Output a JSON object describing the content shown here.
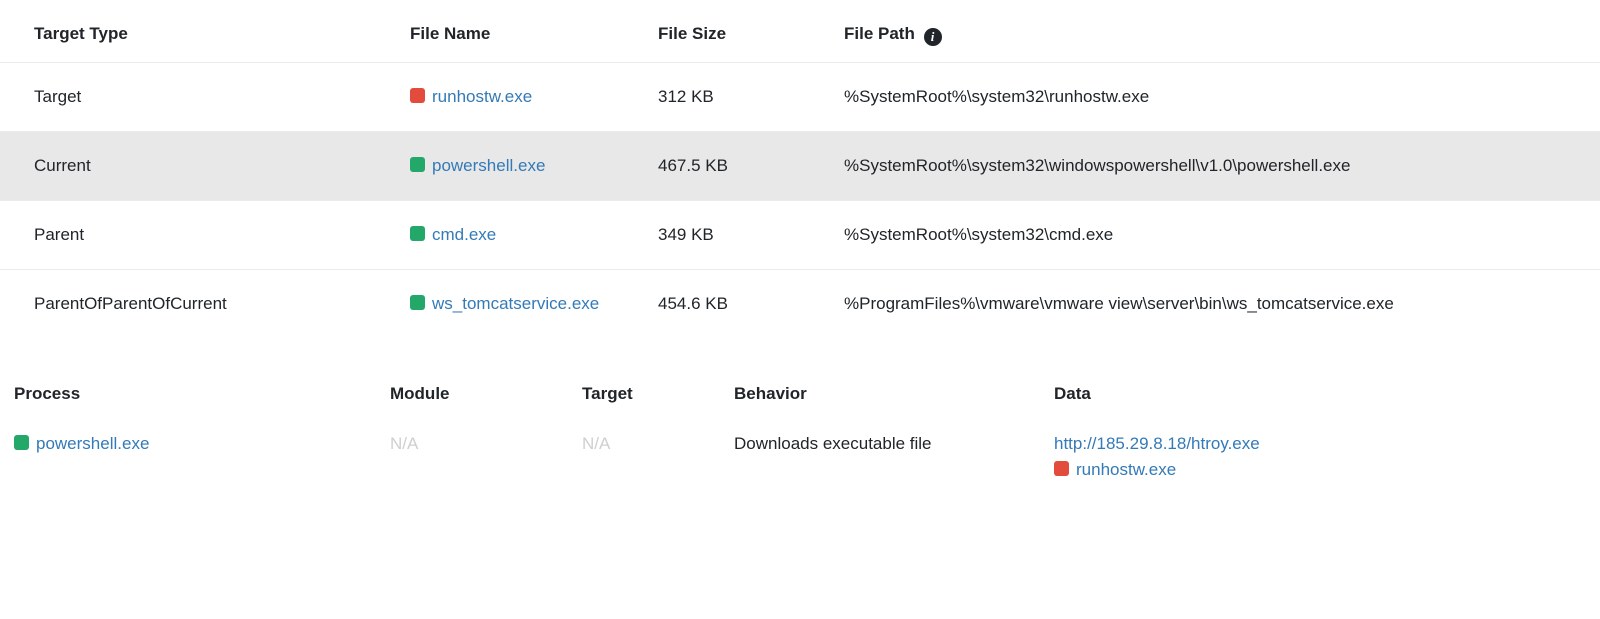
{
  "topTable": {
    "headers": {
      "targetType": "Target Type",
      "fileName": "File Name",
      "fileSize": "File Size",
      "filePath": "File Path"
    },
    "rows": [
      {
        "targetType": "Target",
        "fileName": "runhostw.exe",
        "fileSize": "312 KB",
        "filePath": "%SystemRoot%\\system32\\runhostw.exe",
        "status": "red",
        "alt": false
      },
      {
        "targetType": "Current",
        "fileName": "powershell.exe",
        "fileSize": "467.5 KB",
        "filePath": "%SystemRoot%\\system32\\windowspowershell\\v1.0\\powershell.exe",
        "status": "green",
        "alt": true
      },
      {
        "targetType": "Parent",
        "fileName": "cmd.exe",
        "fileSize": "349 KB",
        "filePath": "%SystemRoot%\\system32\\cmd.exe",
        "status": "green",
        "alt": false
      },
      {
        "targetType": "ParentOfParentOfCurrent",
        "fileName": "ws_tomcatservice.exe",
        "fileSize": "454.6 KB",
        "filePath": "%ProgramFiles%\\vmware\\vmware view\\server\\bin\\ws_tomcatservice.exe",
        "status": "green",
        "alt": false
      }
    ]
  },
  "bottomTable": {
    "headers": {
      "process": "Process",
      "module": "Module",
      "target": "Target",
      "behavior": "Behavior",
      "data": "Data"
    },
    "rows": [
      {
        "process": "powershell.exe",
        "processStatus": "green",
        "module": "N/A",
        "target": "N/A",
        "behavior": "Downloads executable file",
        "dataLines": [
          {
            "text": "http://185.29.8.18/htroy.exe",
            "status": ""
          },
          {
            "text": "runhostw.exe",
            "status": "red"
          }
        ]
      }
    ]
  },
  "infoGlyph": "i"
}
